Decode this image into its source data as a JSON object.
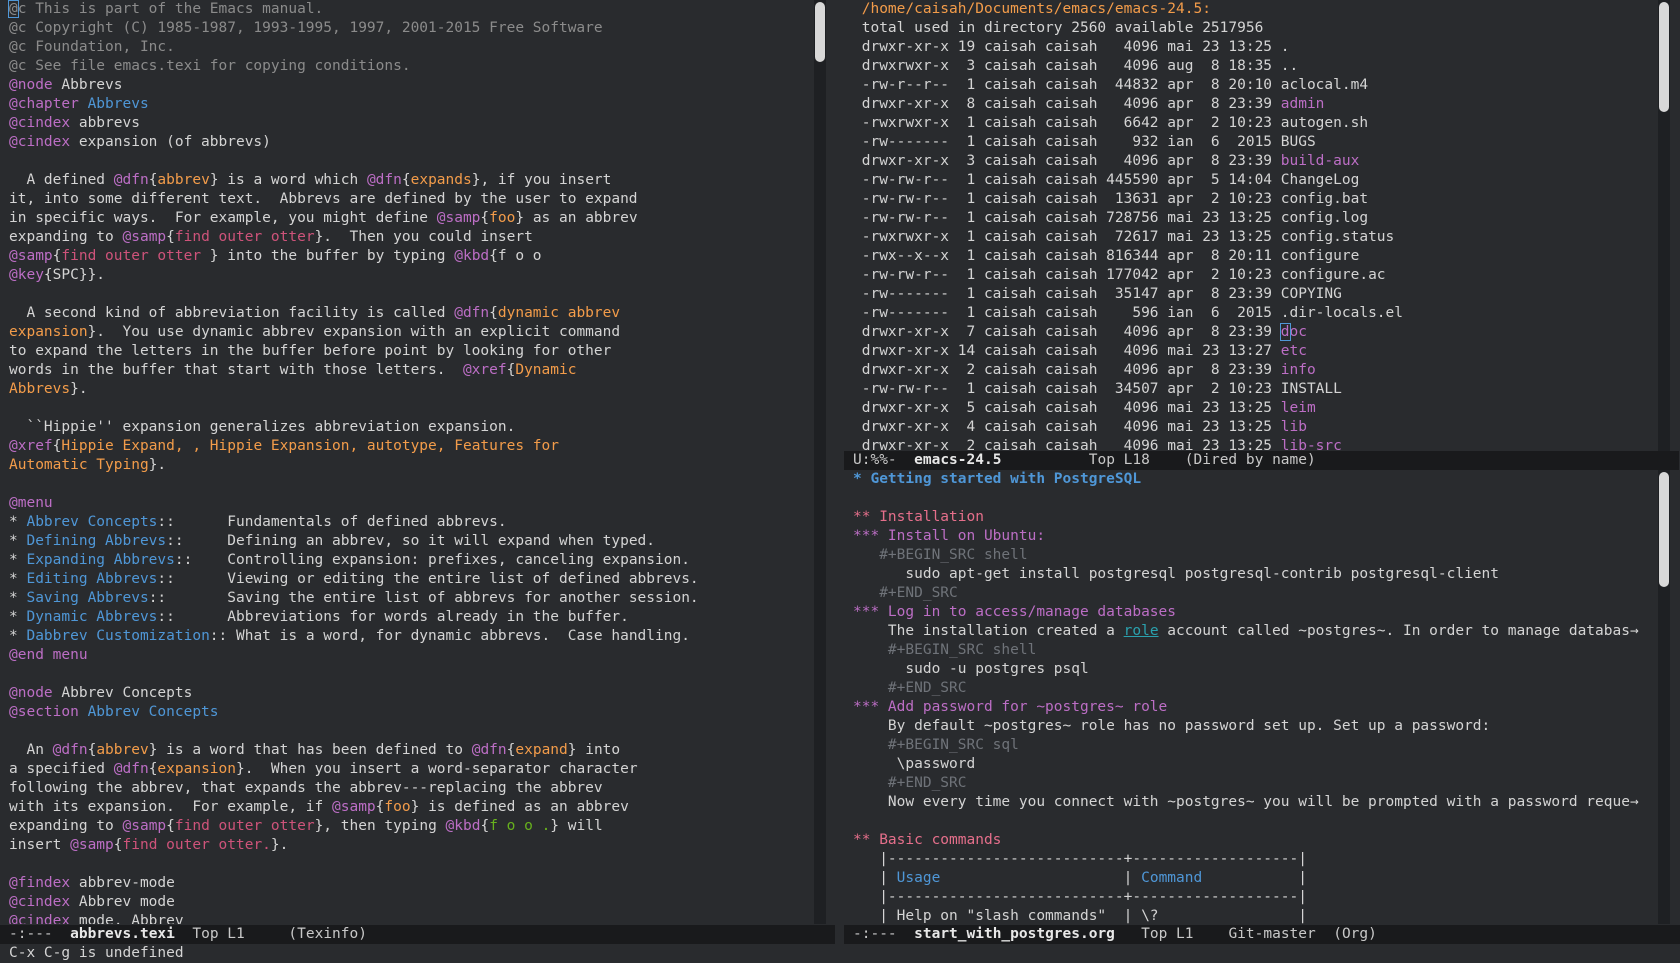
{
  "left": {
    "lines": [
      [
        [
          "c-comment",
          "@c This is part of the Emacs manual."
        ]
      ],
      [
        [
          "c-comment",
          "@c Copyright (C) 1985-1987, 1993-1995, 1997, 2001-2015 Free Software"
        ]
      ],
      [
        [
          "c-comment",
          "@c Foundation, Inc."
        ]
      ],
      [
        [
          "c-comment",
          "@c See file emacs.texi for copying conditions."
        ]
      ],
      [
        [
          "c-kw",
          "@node"
        ],
        [
          "",
          "Abbrevs"
        ]
      ],
      [
        [
          "c-kw",
          "@chapter"
        ],
        [
          "c-blue",
          "Abbrevs"
        ]
      ],
      [
        [
          "c-kw",
          "@cindex"
        ],
        [
          "",
          "abbrevs"
        ]
      ],
      [
        [
          "c-kw",
          "@cindex"
        ],
        [
          "",
          "expansion (of abbrevs)"
        ]
      ],
      [
        [
          "",
          ""
        ]
      ],
      [
        [
          "",
          "  A defined "
        ],
        [
          "c-kw",
          "@dfn"
        ],
        [
          "",
          "{"
        ],
        [
          "c-str",
          "abbrev"
        ],
        [
          "",
          "} is a word which "
        ],
        [
          "c-kw",
          "@dfn"
        ],
        [
          "",
          "{"
        ],
        [
          "c-str",
          "expands"
        ],
        [
          "",
          "}, if you insert"
        ]
      ],
      [
        [
          "",
          "it, into some different text.  Abbrevs are defined by the user to expand"
        ]
      ],
      [
        [
          "",
          "in specific ways.  For example, you might define "
        ],
        [
          "c-kw",
          "@samp"
        ],
        [
          "",
          "{"
        ],
        [
          "c-str",
          "foo"
        ],
        [
          "",
          "} as an abbrev"
        ]
      ],
      [
        [
          "",
          "expanding to "
        ],
        [
          "c-kw",
          "@samp"
        ],
        [
          "",
          "{"
        ],
        [
          "c-pink",
          "find outer otter"
        ],
        [
          "",
          "}.  Then you could insert"
        ]
      ],
      [
        [
          "c-kw",
          "@samp"
        ],
        [
          "",
          "{"
        ],
        [
          "c-pink",
          "find outer otter "
        ],
        [
          "",
          "} into the buffer by typing "
        ],
        [
          "c-kw",
          "@kbd"
        ],
        [
          "",
          "{f o o"
        ]
      ],
      [
        [
          "c-kw",
          "@key"
        ],
        [
          "",
          "{SPC}}."
        ]
      ],
      [
        [
          "",
          ""
        ]
      ],
      [
        [
          "",
          "  A second kind of abbreviation facility is called "
        ],
        [
          "c-kw",
          "@dfn"
        ],
        [
          "",
          "{"
        ],
        [
          "c-str",
          "dynamic abbrev"
        ]
      ],
      [
        [
          "c-str",
          "expansion"
        ],
        [
          "",
          "}.  You use dynamic abbrev expansion with an explicit command"
        ]
      ],
      [
        [
          "",
          "to expand the letters in the buffer before point by looking for other"
        ]
      ],
      [
        [
          "",
          "words in the buffer that start with those letters.  "
        ],
        [
          "c-kw",
          "@xref"
        ],
        [
          "",
          "{"
        ],
        [
          "c-str",
          "Dynamic"
        ]
      ],
      [
        [
          "c-str",
          "Abbrevs"
        ],
        [
          "",
          "}."
        ]
      ],
      [
        [
          "",
          ""
        ]
      ],
      [
        [
          "",
          "  ``Hippie'' expansion generalizes abbreviation expansion."
        ]
      ],
      [
        [
          "c-kw",
          "@xref"
        ],
        [
          "",
          "{"
        ],
        [
          "c-str",
          "Hippie Expand, , Hippie Expansion, autotype, Features for"
        ]
      ],
      [
        [
          "c-str",
          "Automatic Typing"
        ],
        [
          "",
          "}."
        ]
      ],
      [
        [
          "",
          ""
        ]
      ],
      [
        [
          "c-kw",
          "@menu"
        ]
      ],
      [
        [
          "",
          "* "
        ],
        [
          "c-blue",
          "Abbrev Concepts"
        ],
        [
          "",
          "::      Fundamentals of defined abbrevs."
        ]
      ],
      [
        [
          "",
          "* "
        ],
        [
          "c-blue",
          "Defining Abbrevs"
        ],
        [
          "",
          "::     Defining an abbrev, so it will expand when typed."
        ]
      ],
      [
        [
          "",
          "* "
        ],
        [
          "c-blue",
          "Expanding Abbrevs"
        ],
        [
          "",
          "::    Controlling expansion: prefixes, canceling expansion."
        ]
      ],
      [
        [
          "",
          "* "
        ],
        [
          "c-blue",
          "Editing Abbrevs"
        ],
        [
          "",
          "::      Viewing or editing the entire list of defined abbrevs."
        ]
      ],
      [
        [
          "",
          "* "
        ],
        [
          "c-blue",
          "Saving Abbrevs"
        ],
        [
          "",
          "::       Saving the entire list of abbrevs for another session."
        ]
      ],
      [
        [
          "",
          "* "
        ],
        [
          "c-blue",
          "Dynamic Abbrevs"
        ],
        [
          "",
          "::      Abbreviations for words already in the buffer."
        ]
      ],
      [
        [
          "",
          "* "
        ],
        [
          "c-blue",
          "Dabbrev Customization"
        ],
        [
          "",
          ":: What is a word, for dynamic abbrevs.  Case handling."
        ]
      ],
      [
        [
          "c-kw",
          "@end menu"
        ]
      ],
      [
        [
          "",
          ""
        ]
      ],
      [
        [
          "c-kw",
          "@node"
        ],
        [
          "",
          "Abbrev Concepts"
        ]
      ],
      [
        [
          "c-kw",
          "@section"
        ],
        [
          "c-blue",
          "Abbrev Concepts"
        ]
      ],
      [
        [
          "",
          ""
        ]
      ],
      [
        [
          "",
          "  An "
        ],
        [
          "c-kw",
          "@dfn"
        ],
        [
          "",
          "{"
        ],
        [
          "c-str",
          "abbrev"
        ],
        [
          "",
          "} is a word that has been defined to "
        ],
        [
          "c-kw",
          "@dfn"
        ],
        [
          "",
          "{"
        ],
        [
          "c-str",
          "expand"
        ],
        [
          "",
          "} into"
        ]
      ],
      [
        [
          "",
          "a specified "
        ],
        [
          "c-kw",
          "@dfn"
        ],
        [
          "",
          "{"
        ],
        [
          "c-str",
          "expansion"
        ],
        [
          "",
          "}.  When you insert a word-separator character"
        ]
      ],
      [
        [
          "",
          "following the abbrev, that expands the abbrev---replacing the abbrev"
        ]
      ],
      [
        [
          "",
          "with its expansion.  For example, if "
        ],
        [
          "c-kw",
          "@samp"
        ],
        [
          "",
          "{"
        ],
        [
          "c-str",
          "foo"
        ],
        [
          "",
          "} is defined as an abbrev"
        ]
      ],
      [
        [
          "",
          "expanding to "
        ],
        [
          "c-kw",
          "@samp"
        ],
        [
          "",
          "{"
        ],
        [
          "c-pink",
          "find outer otter"
        ],
        [
          "",
          "}, then typing "
        ],
        [
          "c-kw",
          "@kbd"
        ],
        [
          "",
          "{"
        ],
        [
          "c-green",
          "f o o ."
        ],
        [
          "",
          "} will"
        ]
      ],
      [
        [
          "",
          "insert "
        ],
        [
          "c-kw",
          "@samp"
        ],
        [
          "",
          "{"
        ],
        [
          "c-pink",
          "find outer otter."
        ],
        [
          "",
          "}."
        ]
      ],
      [
        [
          "",
          ""
        ]
      ],
      [
        [
          "c-kw",
          "@findex"
        ],
        [
          "",
          "abbrev-mode"
        ]
      ],
      [
        [
          "c-kw",
          "@cindex"
        ],
        [
          "",
          "Abbrev mode"
        ]
      ],
      [
        [
          "c-kw",
          "@cindex"
        ],
        [
          "",
          "mode, Abbrev"
        ]
      ]
    ],
    "modeline": {
      "status": "-:---",
      "buffer": "abbrevs.texi",
      "pos": "Top L1",
      "mode": "(Texinfo)"
    }
  },
  "dired": {
    "header": "/home/caisah/Documents/emacs/emacs-24.5:",
    "total": "total used in directory 2560 available 2517956",
    "rows": [
      {
        "perm": "drwxr-xr-x",
        "n": "19",
        "size": "4096",
        "mon": "mai",
        "day": "23",
        "time": "13:25",
        "name": ".",
        "dir": false
      },
      {
        "perm": "drwxrwxr-x",
        "n": "3",
        "size": "4096",
        "mon": "aug",
        "day": "8",
        "time": "18:35",
        "name": "..",
        "dir": false
      },
      {
        "perm": "-rw-r--r--",
        "n": "1",
        "size": "44832",
        "mon": "apr",
        "day": "8",
        "time": "20:10",
        "name": "aclocal.m4",
        "dir": false
      },
      {
        "perm": "drwxr-xr-x",
        "n": "8",
        "size": "4096",
        "mon": "apr",
        "day": "8",
        "time": "23:39",
        "name": "admin",
        "dir": true
      },
      {
        "perm": "-rwxrwxr-x",
        "n": "1",
        "size": "6642",
        "mon": "apr",
        "day": "2",
        "time": "10:23",
        "name": "autogen.sh",
        "dir": false
      },
      {
        "perm": "-rw-------",
        "n": "1",
        "size": "932",
        "mon": "ian",
        "day": "6",
        "time": "2015",
        "name": "BUGS",
        "dir": false
      },
      {
        "perm": "drwxr-xr-x",
        "n": "3",
        "size": "4096",
        "mon": "apr",
        "day": "8",
        "time": "23:39",
        "name": "build-aux",
        "dir": true
      },
      {
        "perm": "-rw-rw-r--",
        "n": "1",
        "size": "445590",
        "mon": "apr",
        "day": "5",
        "time": "14:04",
        "name": "ChangeLog",
        "dir": false
      },
      {
        "perm": "-rw-rw-r--",
        "n": "1",
        "size": "13631",
        "mon": "apr",
        "day": "2",
        "time": "10:23",
        "name": "config.bat",
        "dir": false
      },
      {
        "perm": "-rw-rw-r--",
        "n": "1",
        "size": "728756",
        "mon": "mai",
        "day": "23",
        "time": "13:25",
        "name": "config.log",
        "dir": false
      },
      {
        "perm": "-rwxrwxr-x",
        "n": "1",
        "size": "72617",
        "mon": "mai",
        "day": "23",
        "time": "13:25",
        "name": "config.status",
        "dir": false
      },
      {
        "perm": "-rwx--x--x",
        "n": "1",
        "size": "816344",
        "mon": "apr",
        "day": "8",
        "time": "20:11",
        "name": "configure",
        "dir": false
      },
      {
        "perm": "-rw-rw-r--",
        "n": "1",
        "size": "177042",
        "mon": "apr",
        "day": "2",
        "time": "10:23",
        "name": "configure.ac",
        "dir": false
      },
      {
        "perm": "-rw-------",
        "n": "1",
        "size": "35147",
        "mon": "apr",
        "day": "8",
        "time": "23:39",
        "name": "COPYING",
        "dir": false
      },
      {
        "perm": "-rw-------",
        "n": "1",
        "size": "596",
        "mon": "ian",
        "day": "6",
        "time": "2015",
        "name": ".dir-locals.el",
        "dir": false
      },
      {
        "perm": "drwxr-xr-x",
        "n": "7",
        "size": "4096",
        "mon": "apr",
        "day": "8",
        "time": "23:39",
        "name": "doc",
        "dir": true
      },
      {
        "perm": "drwxr-xr-x",
        "n": "14",
        "size": "4096",
        "mon": "mai",
        "day": "23",
        "time": "13:27",
        "name": "etc",
        "dir": true
      },
      {
        "perm": "drwxr-xr-x",
        "n": "2",
        "size": "4096",
        "mon": "apr",
        "day": "8",
        "time": "23:39",
        "name": "info",
        "dir": true
      },
      {
        "perm": "-rw-rw-r--",
        "n": "1",
        "size": "34507",
        "mon": "apr",
        "day": "2",
        "time": "10:23",
        "name": "INSTALL",
        "dir": false
      },
      {
        "perm": "drwxr-xr-x",
        "n": "5",
        "size": "4096",
        "mon": "mai",
        "day": "23",
        "time": "13:25",
        "name": "leim",
        "dir": true
      },
      {
        "perm": "drwxr-xr-x",
        "n": "4",
        "size": "4096",
        "mon": "mai",
        "day": "23",
        "time": "13:25",
        "name": "lib",
        "dir": true
      },
      {
        "perm": "drwxr-xr-x",
        "n": "2",
        "size": "4096",
        "mon": "mai",
        "day": "23",
        "time": "13:25",
        "name": "lib-src",
        "dir": true
      }
    ],
    "owner": "caisah",
    "modeline": {
      "status": "U:%%-",
      "buffer": "emacs-24.5",
      "pos": "Top L18",
      "mode": "(Dired by name)"
    }
  },
  "org": {
    "lines": [
      [
        [
          "c-h1",
          "* Getting started with PostgreSQL"
        ]
      ],
      [
        [
          "",
          ""
        ]
      ],
      [
        [
          "c-h2",
          "** Installation"
        ]
      ],
      [
        [
          "c-h3",
          "*** Install on Ubuntu:"
        ]
      ],
      [
        [
          "c-dim",
          "   #+BEGIN_SRC shell"
        ]
      ],
      [
        [
          "",
          "      sudo apt-get install postgresql postgresql-contrib postgresql-client"
        ]
      ],
      [
        [
          "c-dim",
          "   #+END_SRC"
        ]
      ],
      [
        [
          "c-h3",
          "*** Log in to access/manage databases"
        ]
      ],
      [
        [
          "",
          "    The installation created a "
        ],
        [
          "c-cyan",
          "role"
        ],
        [
          "",
          " account called ~postgres~. In order to manage databas→"
        ]
      ],
      [
        [
          "c-dim",
          "    #+BEGIN_SRC shell"
        ]
      ],
      [
        [
          "",
          "      sudo -u postgres psql"
        ]
      ],
      [
        [
          "c-dim",
          "    #+END_SRC"
        ]
      ],
      [
        [
          "c-h3",
          "*** Add password for ~postgres~ role"
        ]
      ],
      [
        [
          "",
          "    By default ~postgres~ role has no password set up. Set up a password:"
        ]
      ],
      [
        [
          "c-dim",
          "    #+BEGIN_SRC sql"
        ]
      ],
      [
        [
          "",
          "     \\password"
        ]
      ],
      [
        [
          "c-dim",
          "    #+END_SRC"
        ]
      ],
      [
        [
          "",
          "    Now every time you connect with ~postgres~ you will be prompted with a password reque→"
        ]
      ],
      [
        [
          "",
          ""
        ]
      ],
      [
        [
          "c-h2",
          "** Basic commands"
        ]
      ],
      [
        [
          "",
          "   |---------------------------+-------------------|"
        ]
      ],
      [
        [
          "",
          "   | "
        ],
        [
          "c-blue",
          "Usage"
        ],
        [
          "",
          "                     | "
        ],
        [
          "c-blue",
          "Command"
        ],
        [
          "",
          "           |"
        ]
      ],
      [
        [
          "",
          "   |---------------------------+-------------------|"
        ]
      ],
      [
        [
          "",
          "   | Help on \"slash commands\"  | \\?                |"
        ]
      ]
    ],
    "modeline": {
      "status": "-:---",
      "buffer": "start_with_postgres.org",
      "pos": "Top L1",
      "vc": "Git-master",
      "mode": "(Org)"
    }
  },
  "echo": "C-x C-g is undefined"
}
